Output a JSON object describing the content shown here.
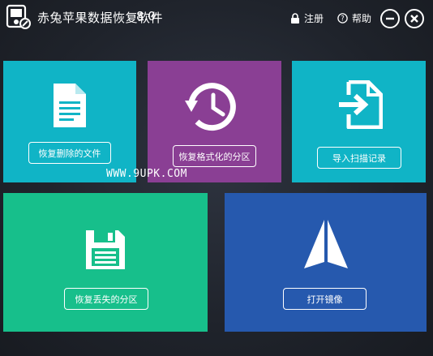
{
  "app": {
    "title": "赤兔苹果数据恢复软件",
    "version": "8.0"
  },
  "titlebar": {
    "register_label": "注册",
    "help_label": "帮助"
  },
  "tiles": [
    {
      "button_label": "恢复删除的文件",
      "color": "#10b4c6",
      "icon": "document-icon"
    },
    {
      "button_label": "恢复格式化的分区",
      "color": "#8a3f94",
      "icon": "history-clock-icon"
    },
    {
      "button_label": "导入扫描记录",
      "color": "#10b4c6",
      "icon": "import-file-icon"
    },
    {
      "button_label": "恢复丢失的分区",
      "color": "#17bf8b",
      "icon": "floppy-disk-icon"
    },
    {
      "button_label": "打开镜像",
      "color": "#2659ae",
      "icon": "disk-image-icon"
    }
  ],
  "watermark": "WWW.9UPK.COM"
}
